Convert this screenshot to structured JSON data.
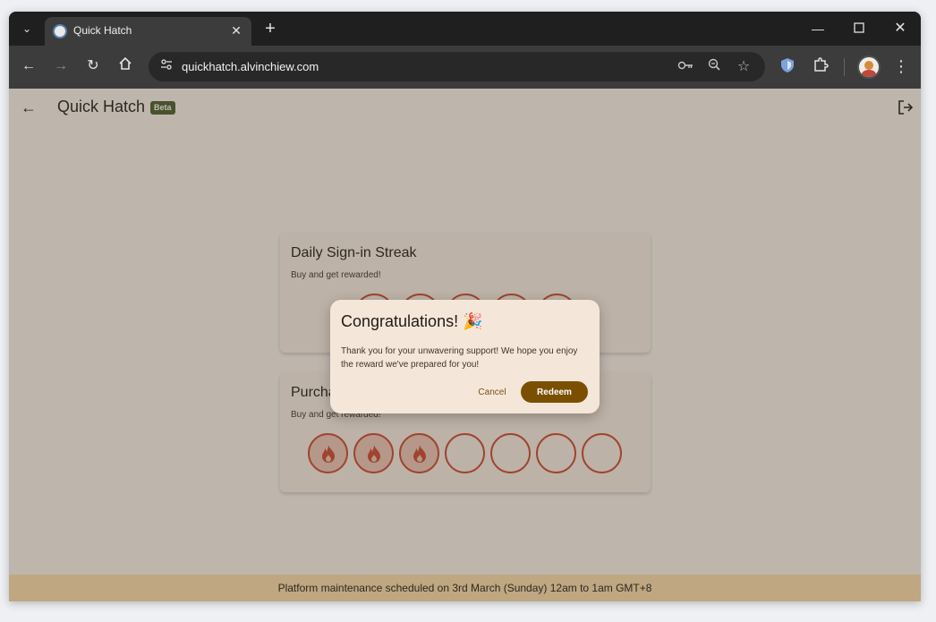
{
  "browser": {
    "tab_title": "Quick Hatch",
    "url": "quickhatch.alvinchiew.com",
    "icons": [
      "chevron-down-icon",
      "close-icon",
      "plus-icon",
      "minimize-icon",
      "maximize-icon",
      "back-icon",
      "forward-icon",
      "reload-icon",
      "home-icon",
      "site-settings-icon",
      "password-key-icon",
      "zoom-icon",
      "star-icon",
      "shield-extension-icon",
      "puzzle-icon",
      "profile-avatar",
      "kebab-menu-icon"
    ]
  },
  "app": {
    "title": "Quick Hatch",
    "badge": "Beta"
  },
  "cards": [
    {
      "title": "Daily Sign-in Streak",
      "subtitle": "Buy and get rewarded!",
      "stamps_total": 5,
      "stamps_filled": 0
    },
    {
      "title": "Purchase",
      "subtitle": "Buy and get rewarded!",
      "stamps_total": 7,
      "stamps_filled": 3
    }
  ],
  "dialog": {
    "title": "Congratulations! 🎉",
    "body": "Thank you for your unwavering support! We hope you enjoy the reward we've prepared for you!",
    "cancel_label": "Cancel",
    "redeem_label": "Redeem"
  },
  "footer": {
    "notice": "Platform maintenance scheduled on 3rd March (Sunday) 12am to 1am GMT+8"
  },
  "colors": {
    "stamp_border": "#d2472f",
    "primary_button": "#7a5000",
    "footer_bg": "#ffe0ad"
  }
}
